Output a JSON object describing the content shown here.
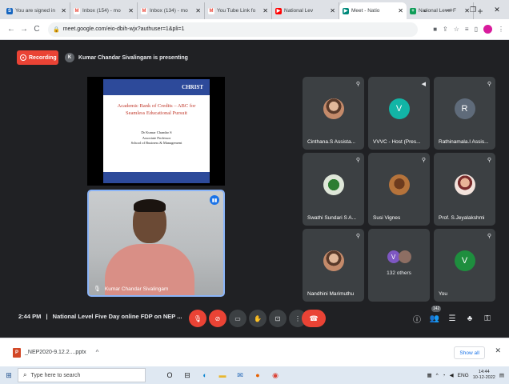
{
  "browser": {
    "tabs": [
      {
        "title": "You are signed in",
        "fav_color": "#1565c0",
        "fav_glyph": "S"
      },
      {
        "title": "Inbox (154) - mo",
        "fav_color": "#ea4335",
        "fav_glyph": "M"
      },
      {
        "title": "Inbox (134) - mo",
        "fav_color": "#ea4335",
        "fav_glyph": "M"
      },
      {
        "title": "You Tube Link fo",
        "fav_color": "#ea4335",
        "fav_glyph": "M"
      },
      {
        "title": "National Lev",
        "fav_color": "#ff0000",
        "fav_glyph": "▶"
      },
      {
        "title": "Meet - Natio",
        "fav_color": "#00897b",
        "fav_glyph": "▶"
      },
      {
        "title": "National Level F",
        "fav_color": "#0f9d58",
        "fav_glyph": "+"
      }
    ],
    "url": "meet.google.com/eio-dbih-wjx?authuser=1&pli=1"
  },
  "meet": {
    "recording_label": "Recording",
    "presenter_initial": "K",
    "presenter_text": "Kumar Chandar Sivalingam is presenting",
    "slide": {
      "logo": "CHRIST",
      "title": "Academic Bank of Credits – ABC for Seamless Educational Pursuit",
      "author": "Dr Kumar Chandar S",
      "role": "Associate Professor",
      "dept": "School of Business & Management"
    },
    "speaker_name": "Kumar Chandar Sivalingam",
    "participants": [
      {
        "name": "Cinthana.S Assista...",
        "avatar_type": "photo",
        "initial": "",
        "color": ""
      },
      {
        "name": "VVVC - Host (Pres...",
        "avatar_type": "letter",
        "initial": "V",
        "color": "#12b5a6"
      },
      {
        "name": "Rathinamala.I Assis...",
        "avatar_type": "letter",
        "initial": "R",
        "color": "#5f6b7a"
      },
      {
        "name": "Swathi Sundari S A...",
        "avatar_type": "plant",
        "initial": "",
        "color": ""
      },
      {
        "name": "Susi Vignes",
        "avatar_type": "deco",
        "initial": "",
        "color": ""
      },
      {
        "name": "Prof. S.Jeyalakshmi",
        "avatar_type": "lady",
        "initial": "",
        "color": ""
      },
      {
        "name": "Nandhini Marimuthu",
        "avatar_type": "photo",
        "initial": "",
        "color": ""
      },
      {
        "name": "132 others",
        "avatar_type": "group",
        "initial": "V",
        "color": "#7e57c2"
      },
      {
        "name": "You",
        "avatar_type": "letter",
        "initial": "V",
        "color": "#1e8e3e"
      }
    ],
    "time": "2:44 PM",
    "separator": "|",
    "meeting_title": "National Level Five Day online FDP on NEP ...",
    "people_count": "142"
  },
  "downloads": {
    "file_name": "_NEP2020-9.12.2....pptx",
    "show_all": "Show all"
  },
  "taskbar": {
    "search_placeholder": "Type here to search",
    "lang": "ENG",
    "time": "14:44",
    "date": "10-12-2022"
  }
}
